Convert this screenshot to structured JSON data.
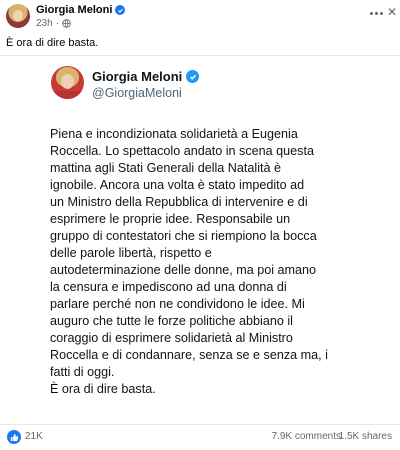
{
  "post": {
    "author": "Giorgia Meloni",
    "time": "23h",
    "dot": "·",
    "caption": "È ora di dire basta."
  },
  "tweet": {
    "name": "Giorgia Meloni",
    "handle": "@GiorgiaMeloni",
    "lines": [
      "Piena e incondizionata solidarietà a Eugenia",
      "Roccella. Lo spettacolo andato in scena questa",
      "mattina agli Stati Generali della Natalità è",
      "ignobile. Ancora una volta è stato impedito ad",
      "un Ministro della Repubblica di intervenire e di",
      "esprimere le proprie idee. Responsabile un",
      "gruppo di contestatori che si riempiono la bocca",
      "delle parole libertà, rispetto e",
      "autodeterminazione delle donne, ma poi amano",
      "la censura e impediscono ad una donna di",
      "parlare perché non ne condividono le idee. Mi",
      "auguro che tutte le forze politiche abbiano il",
      "coraggio di esprimere solidarietà al Ministro",
      "Roccella e di condannare, senza se e senza ma, i",
      "fatti di oggi.",
      "È ora di dire basta."
    ]
  },
  "footer": {
    "likes": "21K",
    "comments": "7.9K comments",
    "shares": "1.5K shares"
  },
  "colors": {
    "facebook_blue": "#1877f2",
    "twitter_verified": "#1d9bf0",
    "meta_gray": "#65676b"
  },
  "icons": {
    "verified": "verified-check-icon",
    "audience": "globe-icon",
    "more": "more-dots-icon",
    "close": "close-icon",
    "like": "like-thumb-icon"
  }
}
